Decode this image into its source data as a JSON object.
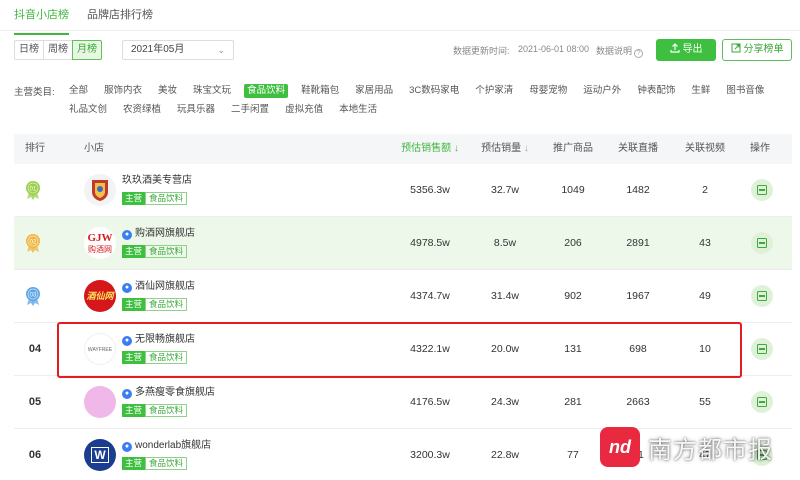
{
  "tabs": [
    {
      "label": "抖音小店榜"
    },
    {
      "label": "品牌店排行榜"
    }
  ],
  "period": {
    "options": [
      "日榜",
      "周榜",
      "月榜"
    ],
    "selected": "月榜",
    "month": "2021年05月"
  },
  "meta": {
    "update_label": "数据更新时间:",
    "update_time": "2021-06-01 08:00",
    "explain_label": "数据说明"
  },
  "actions": {
    "export_label": "导出",
    "share_label": "分享榜单"
  },
  "categories": {
    "label": "主营类目:",
    "row1": [
      "全部",
      "服饰内衣",
      "美妆",
      "珠宝文玩",
      "食品饮料",
      "鞋靴箱包",
      "家居用品",
      "3C数码家电",
      "个护家清",
      "母婴宠物",
      "运动户外",
      "钟表配饰",
      "生鲜",
      "图书音像"
    ],
    "row2": [
      "礼品文创",
      "农资绿植",
      "玩具乐器",
      "二手闲置",
      "虚拟充值",
      "本地生活"
    ],
    "selected": "食品饮料"
  },
  "table": {
    "headers": {
      "rank": "排行",
      "shop": "小店",
      "sales_amount": "预估销售额",
      "sales_volume": "预估销量",
      "products": "推广商品",
      "lives": "关联直播",
      "videos": "关联视频",
      "ops": "操作"
    },
    "main_tag": "主营",
    "rows": [
      {
        "rank": "01",
        "name": "玖玖酒美专营店",
        "verified": false,
        "category": "食品饮料",
        "sales_amount": "5356.3w",
        "sales_volume": "32.7w",
        "products": "1049",
        "lives": "1482",
        "videos": "2",
        "avatar_color": "#f3f3f3",
        "avatar_text": "",
        "medal_color": "#9ccf48"
      },
      {
        "rank": "02",
        "name": "购酒网旗舰店",
        "verified": true,
        "category": "食品饮料",
        "sales_amount": "4978.5w",
        "sales_volume": "8.5w",
        "products": "206",
        "lives": "2891",
        "videos": "43",
        "avatar_color": "#ffffff",
        "avatar_text": "GJW",
        "avatar_sub": "购酒网",
        "medal_color": "#f0b643"
      },
      {
        "rank": "03",
        "name": "酒仙网旗舰店",
        "verified": true,
        "category": "食品饮料",
        "sales_amount": "4374.7w",
        "sales_volume": "31.4w",
        "products": "902",
        "lives": "1967",
        "videos": "49",
        "avatar_color": "#d5171c",
        "avatar_text": "酒仙网",
        "medal_color": "#5fa5e5"
      },
      {
        "rank": "04",
        "name": "无限畅旗舰店",
        "verified": true,
        "category": "食品饮料",
        "sales_amount": "4322.1w",
        "sales_volume": "20.0w",
        "products": "131",
        "lives": "698",
        "videos": "10",
        "avatar_color": "#ffffff",
        "avatar_text": "WAYFREE"
      },
      {
        "rank": "05",
        "name": "多燕瘦零食旗舰店",
        "verified": true,
        "category": "食品饮料",
        "sales_amount": "4176.5w",
        "sales_volume": "24.3w",
        "products": "281",
        "lives": "2663",
        "videos": "55",
        "avatar_color": "#f0b8e8",
        "avatar_text": ""
      },
      {
        "rank": "06",
        "name": "wonderlab旗舰店",
        "verified": true,
        "category": "食品饮料",
        "sales_amount": "3200.3w",
        "sales_volume": "22.8w",
        "products": "77",
        "lives": "61",
        "videos": "47",
        "avatar_color": "#1b3d8f",
        "avatar_text": "W"
      }
    ]
  },
  "watermark": {
    "logo": "nd",
    "text": "南方都市报"
  }
}
